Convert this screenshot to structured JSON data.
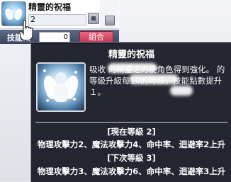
{
  "skill_window": {
    "skill_name": "精靈的祝福",
    "skill_level": "2",
    "sp_label": "技能點",
    "sp_value": "0",
    "combine_button": "組合"
  },
  "tooltip": {
    "title": "精靈的祝福",
    "description": "吸收                    的精靈之力使角色得到強化。                的等級升級每10的時候，技能點數提升１。",
    "current_level_header": "[現在等級 2]",
    "current_level_effect": "物理攻擊力2、魔法攻擊力4、命中率、迴避率2上升",
    "next_level_header": "[下次等級 3]",
    "next_level_effect": "物理攻擊力3、魔法攻擊力6、命中率、迴避率3上升"
  },
  "colors": {
    "tooltip_bg": "#141822",
    "combine_button": "#d44663",
    "skill_bar": "#46516f"
  },
  "icons": {
    "skill": "angel-wings-icon",
    "cursor": "hand-cursor-icon"
  }
}
